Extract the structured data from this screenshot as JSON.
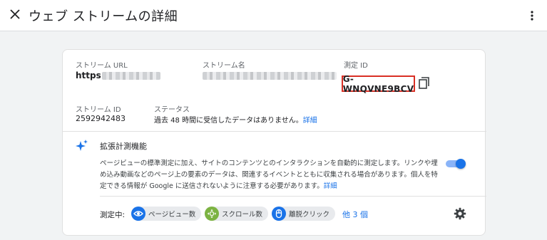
{
  "header": {
    "title": "ウェブ ストリームの詳細"
  },
  "stream": {
    "url_label": "ストリーム URL",
    "url_value": "https://",
    "name_label": "ストリーム名",
    "measurement_id_label": "測定 ID",
    "measurement_id": "G-WNQVNE9BCV",
    "stream_id_label": "ストリーム ID",
    "stream_id": "2592942483",
    "status_label": "ステータス",
    "status_text": "過去 48 時間に受信したデータはありません。",
    "status_link": "詳細"
  },
  "enhanced": {
    "title": "拡張計測機能",
    "description": "ページビューの標準測定に加え、サイトのコンテンツとのインタラクションを自動的に測定します。リンクや埋め込み動画などのページ上の要素のデータは、関連するイベントとともに収集される場合があります。個人を特定できる情報が Google に送信されないように注意する必要があります。",
    "details_link": "詳細",
    "toggle_on": true,
    "measuring_label": "測定中:",
    "chips": [
      {
        "label": "ページビュー数",
        "icon": "eye-icon",
        "color": "#1a73e8",
        "bg": "#d2e3fc"
      },
      {
        "label": "スクロール数",
        "icon": "scroll-icon",
        "color": "#7cb342",
        "bg": "#ffffff"
      },
      {
        "label": "離脱クリック",
        "icon": "mouse-icon",
        "color": "#1a73e8",
        "bg": "#1a73e8"
      }
    ],
    "more_link": "他 3 個"
  },
  "colors": {
    "accent": "#1a73e8",
    "highlight_border": "#d93025"
  }
}
